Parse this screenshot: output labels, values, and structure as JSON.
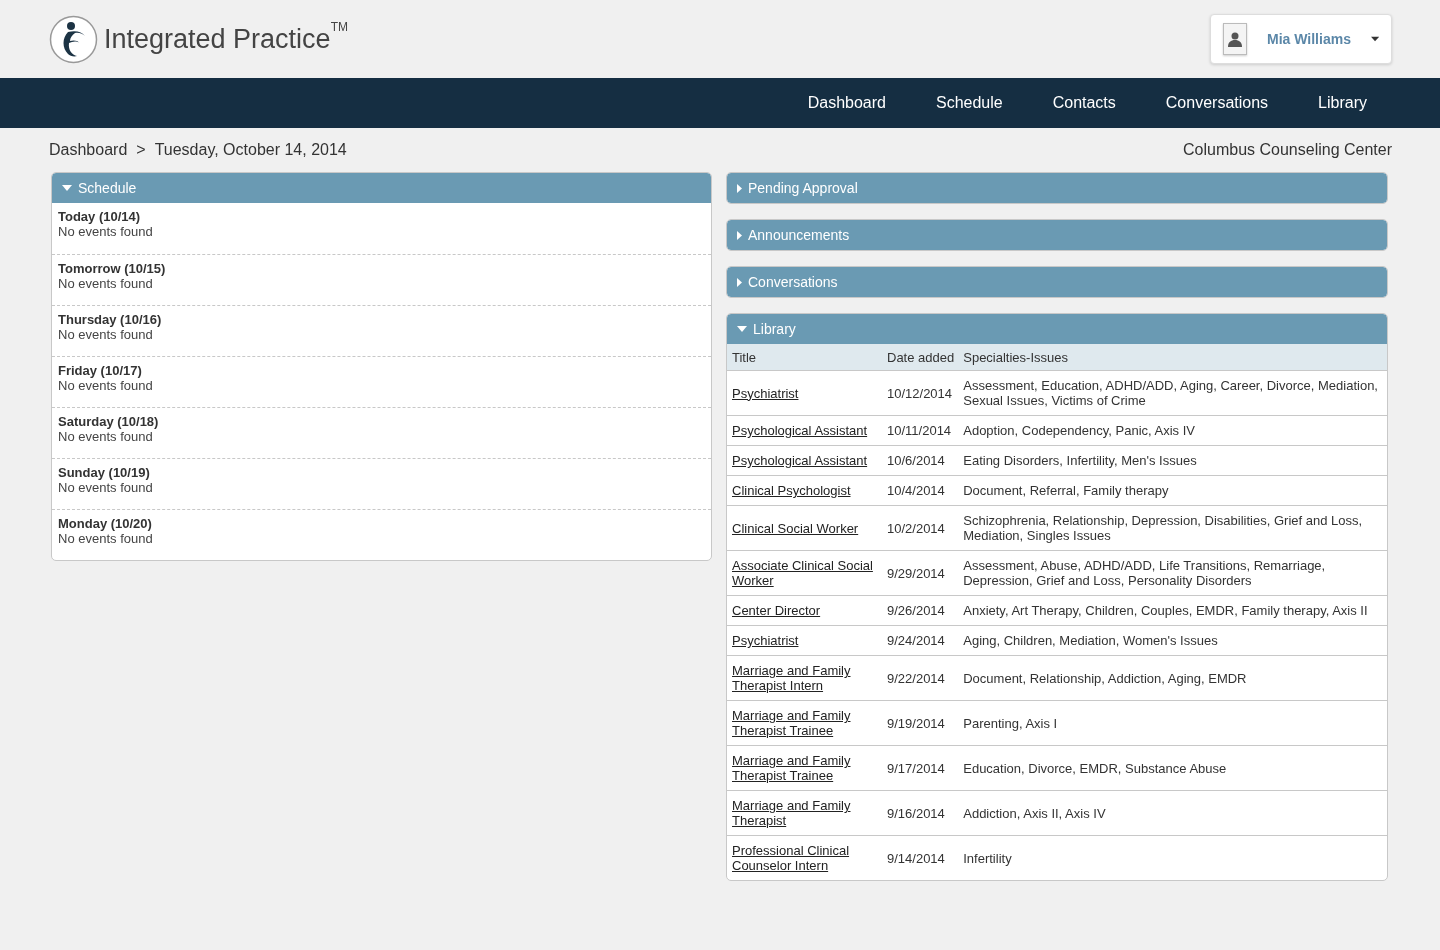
{
  "header": {
    "logo_text": "Integrated Practice$^{TM}$",
    "user": {
      "name": "Mia Williams"
    }
  },
  "nav": [
    {
      "label": "Dashboard"
    },
    {
      "label": "Schedule"
    },
    {
      "label": "Contacts"
    },
    {
      "label": "Conversations"
    },
    {
      "label": "Library"
    }
  ],
  "breadcrumb": {
    "items": [
      "Dashboard",
      "Tuesday, October 14, 2014"
    ],
    "separator": ">",
    "center_name": "Columbus Counseling Center"
  },
  "schedule": {
    "title": "Schedule",
    "expanded": true,
    "days": [
      {
        "label": "Today (10/14)",
        "events": "No events found"
      },
      {
        "label": "Tomorrow (10/15)",
        "events": "No events found"
      },
      {
        "label": "Thursday (10/16)",
        "events": "No events found"
      },
      {
        "label": "Friday (10/17)",
        "events": "No events found"
      },
      {
        "label": "Saturday (10/18)",
        "events": "No events found"
      },
      {
        "label": "Sunday (10/19)",
        "events": "No events found"
      },
      {
        "label": "Monday (10/20)",
        "events": "No events found"
      }
    ]
  },
  "panels": [
    {
      "title": "Pending Approval",
      "expanded": false
    },
    {
      "title": "Announcements",
      "expanded": false
    },
    {
      "title": "Conversations",
      "expanded": false
    }
  ],
  "library": {
    "title": "Library",
    "expanded": true,
    "columns": [
      "Title",
      "Date added",
      "Specialties-Issues"
    ],
    "rows": [
      {
        "title": "Psychiatrist",
        "date": "10/12/2014",
        "issues": "Assessment, Education, ADHD/ADD, Aging, Career, Divorce, Mediation, Sexual Issues, Victims of Crime"
      },
      {
        "title": "Psychological Assistant",
        "date": "10/11/2014",
        "issues": "Adoption, Codependency, Panic, Axis IV"
      },
      {
        "title": "Psychological Assistant",
        "date": "10/6/2014",
        "issues": "Eating Disorders, Infertility, Men's Issues"
      },
      {
        "title": "Clinical Psychologist",
        "date": "10/4/2014",
        "issues": "Document, Referral, Family therapy"
      },
      {
        "title": "Clinical Social Worker",
        "date": "10/2/2014",
        "issues": "Schizophrenia, Relationship, Depression, Disabilities, Grief and Loss, Mediation, Singles Issues"
      },
      {
        "title": "Associate Clinical Social Worker",
        "date": "9/29/2014",
        "issues": "Assessment, Abuse, ADHD/ADD, Life Transitions, Remarriage, Depression, Grief and Loss, Personality Disorders"
      },
      {
        "title": "Center Director",
        "date": "9/26/2014",
        "issues": "Anxiety, Art Therapy, Children, Couples, EMDR, Family therapy, Axis II"
      },
      {
        "title": "Psychiatrist",
        "date": "9/24/2014",
        "issues": "Aging, Children, Mediation, Women's Issues"
      },
      {
        "title": "Marriage and Family Therapist Intern",
        "date": "9/22/2014",
        "issues": "Document, Relationship, Addiction, Aging, EMDR"
      },
      {
        "title": "Marriage and Family Therapist Trainee",
        "date": "9/19/2014",
        "issues": "Parenting, Axis I"
      },
      {
        "title": "Marriage and Family Therapist Trainee",
        "date": "9/17/2014",
        "issues": "Education, Divorce, EMDR, Substance Abuse"
      },
      {
        "title": "Marriage and Family Therapist",
        "date": "9/16/2014",
        "issues": "Addiction, Axis II, Axis IV"
      },
      {
        "title": "Professional Clinical Counselor Intern",
        "date": "9/14/2014",
        "issues": "Infertility"
      }
    ]
  }
}
